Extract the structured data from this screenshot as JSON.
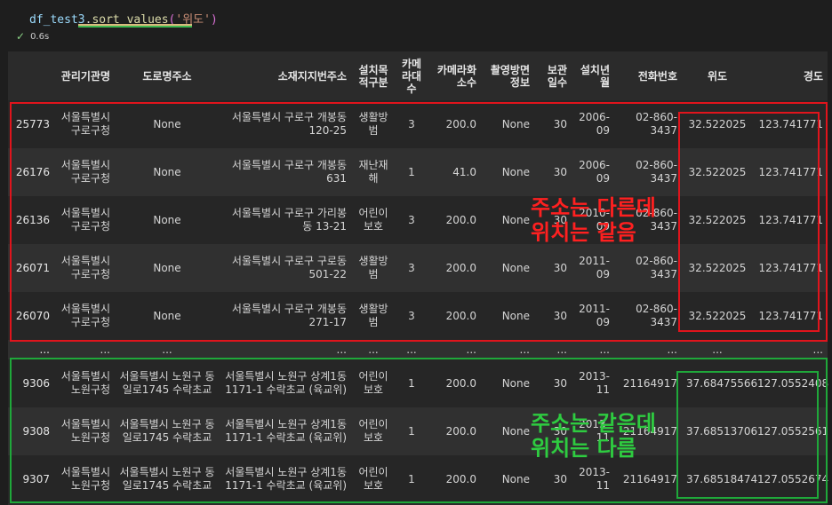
{
  "code": {
    "var": "df_test3",
    "dot": ".",
    "fn": "sort_values",
    "open": "(",
    "arg": "'위도'",
    "close": ")"
  },
  "exec": {
    "check": "✓",
    "time": "0.6s"
  },
  "table": {
    "headers": [
      "",
      "관리기관명",
      "도로명주소",
      "소재지지번주소",
      "설치목적구분",
      "카메라대수",
      "카메라화소수",
      "촬영방면정보",
      "보관일수",
      "설치년월",
      "전화번호",
      "위도",
      "경도"
    ],
    "rows": [
      [
        "25773",
        "서울특별시 구로구청",
        "None",
        "서울특별시 구로구 개봉동 120-25",
        "생활방범",
        "3",
        "200.0",
        "None",
        "30",
        "2006-09",
        "02-860-3437",
        "32.522025",
        "123.741771"
      ],
      [
        "26176",
        "서울특별시 구로구청",
        "None",
        "서울특별시 구로구 개봉동 631",
        "재난재해",
        "1",
        "41.0",
        "None",
        "30",
        "2006-09",
        "02-860-3437",
        "32.522025",
        "123.741771"
      ],
      [
        "26136",
        "서울특별시 구로구청",
        "None",
        "서울특별시 구로구 가리봉동 13-21",
        "어린이보호",
        "3",
        "200.0",
        "None",
        "30",
        "2010-09",
        "02-860-3437",
        "32.522025",
        "123.741771"
      ],
      [
        "26071",
        "서울특별시 구로구청",
        "None",
        "서울특별시 구로구 구로동 501-22",
        "생활방범",
        "3",
        "200.0",
        "None",
        "30",
        "2011-09",
        "02-860-3437",
        "32.522025",
        "123.741771"
      ],
      [
        "26070",
        "서울특별시 구로구청",
        "None",
        "서울특별시 구로구 개봉동 271-17",
        "생활방범",
        "3",
        "200.0",
        "None",
        "30",
        "2011-09",
        "02-860-3437",
        "32.522025",
        "123.741771"
      ],
      [
        "...",
        "...",
        "...",
        "...",
        "...",
        "...",
        "...",
        "...",
        "...",
        "...",
        "...",
        "...",
        "..."
      ],
      [
        "9306",
        "서울특별시 노원구청",
        "서울특별시 노원구 동일로1745 수락초교",
        "서울특별시 노원구 상계1동 1171-1 수락초교 (육교위)",
        "어린이보호",
        "1",
        "200.0",
        "None",
        "30",
        "2013-11",
        "21164917",
        "37.68475566",
        "127.0552408"
      ],
      [
        "9308",
        "서울특별시 노원구청",
        "서울특별시 노원구 동일로1745 수락초교",
        "서울특별시 노원구 상계1동 1171-1 수락초교 (육교위)",
        "어린이보호",
        "1",
        "200.0",
        "None",
        "30",
        "2013-11",
        "21164917",
        "37.68513706",
        "127.0552561"
      ],
      [
        "9307",
        "서울특별시 노원구청",
        "서울특별시 노원구 동일로1745 수락초교",
        "서울특별시 노원구 상계1동 1171-1 수락초교 (육교위)",
        "어린이보호",
        "1",
        "200.0",
        "None",
        "30",
        "2013-11",
        "21164917",
        "37.68518474",
        "127.0552674"
      ]
    ]
  },
  "annotations": {
    "red_line1": "주소는 다른데",
    "red_line2": "위치는 같음",
    "green_line1": "주소는 같은데",
    "green_line2": "위치는 다름"
  },
  "colors": {
    "red": "#e0141c",
    "green": "#1fa83a"
  }
}
